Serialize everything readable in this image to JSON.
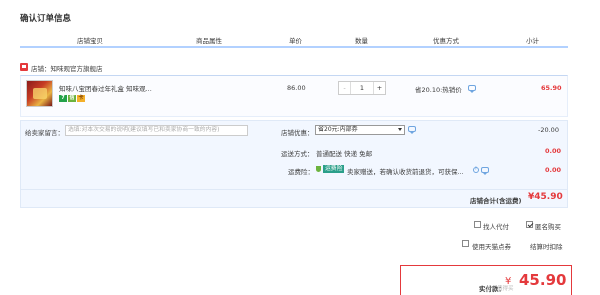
{
  "page": {
    "title": "确认订单信息"
  },
  "columns": [
    "店铺宝贝",
    "商品属性",
    "单价",
    "数量",
    "优惠方式",
    "小计"
  ],
  "shop": {
    "label": "店铺：知味观官方旗舰店"
  },
  "item": {
    "name": "知味八宝团春过年礼盒 知味观...",
    "unit_price": "86.00",
    "quantity": "1",
    "qty_minus": "-",
    "qty_plus": "+",
    "discount": "省20.10:热销价",
    "subtotal": "65.90",
    "badges": [
      "7",
      "信",
      "卡"
    ]
  },
  "remarks": {
    "label": "给卖家留言：",
    "placeholder": "选填:对本次交易的说明(建议填写已和卖家协商一致的内容)"
  },
  "shop_coupon": {
    "label": "店铺优惠：",
    "selected": "省20元:内部券",
    "amount": "-20.00"
  },
  "delivery": {
    "label": "运送方式：",
    "value": "普通配送 快递 免邮",
    "amount": "0.00"
  },
  "shipping_insurance": {
    "label": "运费险：",
    "tag": "运费险",
    "text": "卖家赠送，若确认收货前退货，可获保...",
    "help": "?",
    "amount": "0.00"
  },
  "shop_total": {
    "label": "店铺合计(含运费)",
    "value": "¥45.90"
  },
  "options": {
    "proxy_pay": "找人代付",
    "anonymous": "匿名购买",
    "tmall_points": "使用天猫点券",
    "points_note": "结算时扣除"
  },
  "payment": {
    "label": "实付款：",
    "currency": "¥",
    "value": "45.90"
  },
  "watermark": "什么值得买"
}
